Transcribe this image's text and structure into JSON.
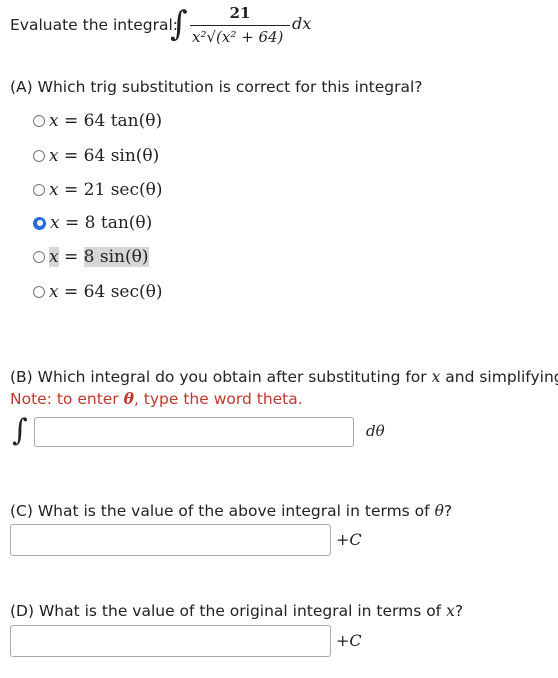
{
  "header": {
    "intro": "Evaluate the integral:",
    "numerator": "21",
    "denominator": "x²√(x² + 64)",
    "differential": "dx",
    "integral_symbol": "∫"
  },
  "part_a": {
    "question": "(A) Which trig substitution is correct for this integral?",
    "options": [
      {
        "var": "x",
        "eq": "=",
        "rhs": "64 tan(θ)",
        "selected": false,
        "highlighted": false
      },
      {
        "var": "x",
        "eq": "=",
        "rhs": "64 sin(θ)",
        "selected": false,
        "highlighted": false
      },
      {
        "var": "x",
        "eq": "=",
        "rhs": "21 sec(θ)",
        "selected": false,
        "highlighted": false
      },
      {
        "var": "x",
        "eq": "=",
        "rhs": "8 tan(θ)",
        "selected": true,
        "highlighted": false
      },
      {
        "var": "x",
        "eq": "=",
        "rhs": "8 sin(θ)",
        "selected": false,
        "highlighted": true
      },
      {
        "var": "x",
        "eq": "=",
        "rhs": "64 sec(θ)",
        "selected": false,
        "highlighted": false
      }
    ]
  },
  "part_b": {
    "question_pre": "(B) Which integral do you obtain after substituting for ",
    "question_var": "x",
    "question_post": " and simplifying?",
    "note_pre": "Note: to enter ",
    "note_var": "θ",
    "note_post": ", type the word theta.",
    "integral_symbol": "∫",
    "input_value": "",
    "differential": "dθ"
  },
  "part_c": {
    "question_pre": "(C) What is the value of the above integral in terms of ",
    "question_var": "θ",
    "question_post": "?",
    "input_value": "",
    "suffix": "+C"
  },
  "part_d": {
    "question_pre": "(D) What is the value of the original integral in terms of ",
    "question_var": "x",
    "question_post": "?",
    "input_value": "",
    "suffix": "+C"
  },
  "colors": {
    "accent": "#2a6ad8",
    "note": "#c0392b",
    "highlight": "#d6d6d6"
  }
}
